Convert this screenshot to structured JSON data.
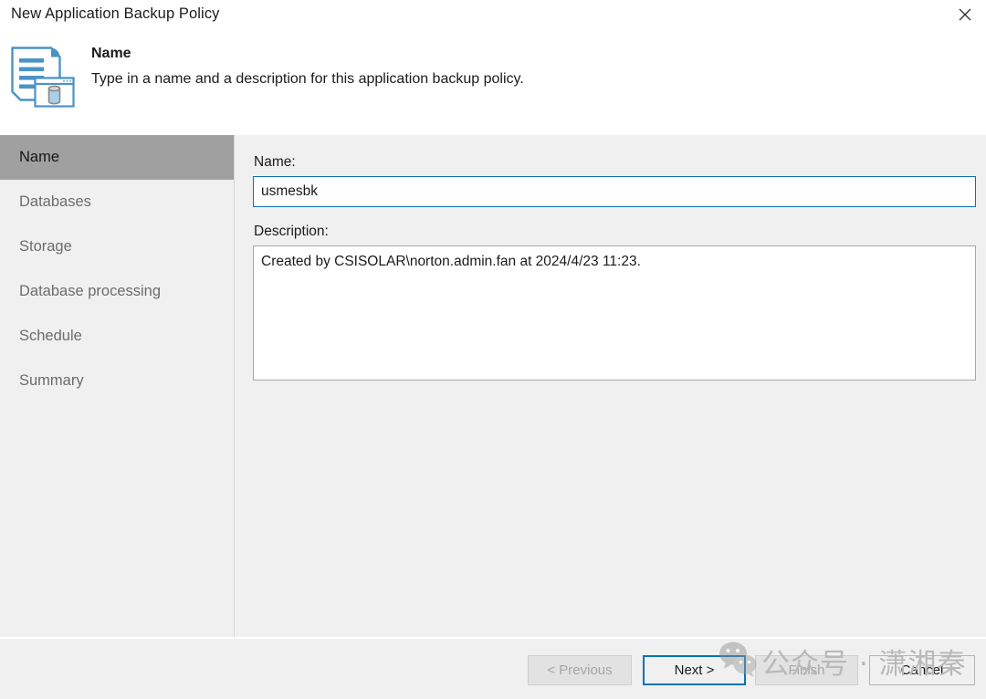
{
  "window": {
    "title": "New Application Backup Policy",
    "close_icon": "close-icon"
  },
  "header": {
    "icon": "document-database-backup-icon",
    "title": "Name",
    "description": "Type in a name and a description for this application backup policy."
  },
  "sidebar": {
    "items": [
      {
        "label": "Name",
        "selected": true
      },
      {
        "label": "Databases",
        "selected": false
      },
      {
        "label": "Storage",
        "selected": false
      },
      {
        "label": "Database processing",
        "selected": false
      },
      {
        "label": "Schedule",
        "selected": false
      },
      {
        "label": "Summary",
        "selected": false
      }
    ]
  },
  "form": {
    "name_label": "Name:",
    "name_value": "usmesbk",
    "name_placeholder": "",
    "description_label": "Description:",
    "description_value": "Created by CSISOLAR\\norton.admin.fan at 2024/4/23 11:23.",
    "description_placeholder": ""
  },
  "footer": {
    "previous_label": "< Previous",
    "next_label": "Next >",
    "finish_label": "Finish",
    "cancel_label": "Cancel"
  },
  "watermark": {
    "text": "公众号 · 潇湘秦",
    "logo_icon": "wechat-logo-icon"
  },
  "colors": {
    "accent": "#0a72b4",
    "selected_nav": "#a0a0a0",
    "panel_bg": "#f0f0f0",
    "icon_blue": "#3f8fc4"
  }
}
